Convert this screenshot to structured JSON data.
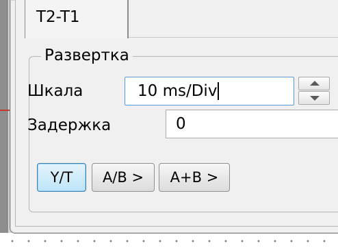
{
  "tab": {
    "label": "T2-T1"
  },
  "sweep": {
    "group_title": "Развертка",
    "scale_label": "Шкала",
    "scale_value": "10 ms/Div",
    "delay_label": "Задержка",
    "delay_value": "0"
  },
  "modes": {
    "yt": "Y/T",
    "ab": "A/B >",
    "apb": "A+B >"
  },
  "colors": {
    "active_button": "#bde4f8",
    "focus_border": "#5b9bd5",
    "trace_marker": "#c0392b"
  }
}
